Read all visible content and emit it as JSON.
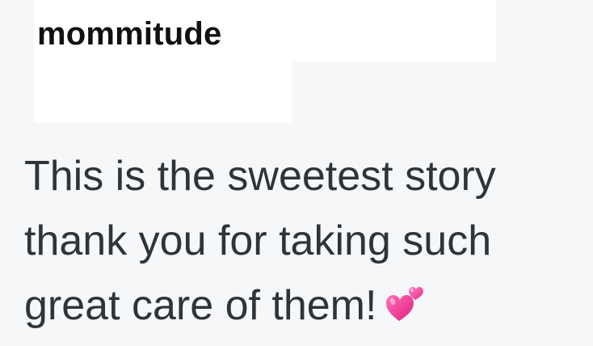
{
  "comment": {
    "username": "mommitude",
    "lines": [
      "This is the sweetest story",
      "thank you for taking such",
      "great care of them!"
    ],
    "emoji_icon": "two-hearts-icon",
    "colors": {
      "background": "#f6f7f9",
      "username_bg": "#ffffff",
      "username_text": "#111111",
      "body_text": "#2f3438",
      "heart": "#f0429a"
    }
  }
}
